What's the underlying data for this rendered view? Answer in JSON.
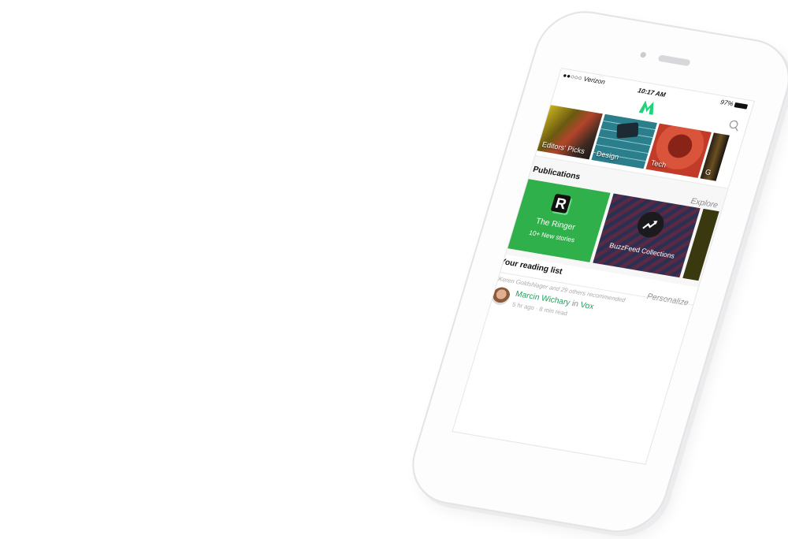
{
  "status_bar": {
    "carrier": "●●○○○ Verizon",
    "time": "10:17 AM",
    "battery": "97%"
  },
  "header": {
    "logo": "Medium",
    "search_icon": "search-icon"
  },
  "topics": [
    {
      "label": "Editors' Picks"
    },
    {
      "label": "Design"
    },
    {
      "label": "Tech"
    },
    {
      "label": "G"
    }
  ],
  "publications": {
    "title": "Publications",
    "explore_label": "Explore",
    "items": [
      {
        "name": "The Ringer",
        "subtitle": "10+  New stories",
        "logo": "R",
        "color": "#2fb04a"
      },
      {
        "name": "BuzzFeed Collections",
        "color": "#2b2f52"
      }
    ]
  },
  "reading_list": {
    "title": "Your reading list",
    "personalize_label": "Personalize",
    "items": [
      {
        "recommended": "Keren Goldshlager and 29 others recommended",
        "author": "Marcin Wichary",
        "in": "in",
        "publication": "Vox",
        "meta": "5 hr ago · 8 min read"
      }
    ]
  }
}
